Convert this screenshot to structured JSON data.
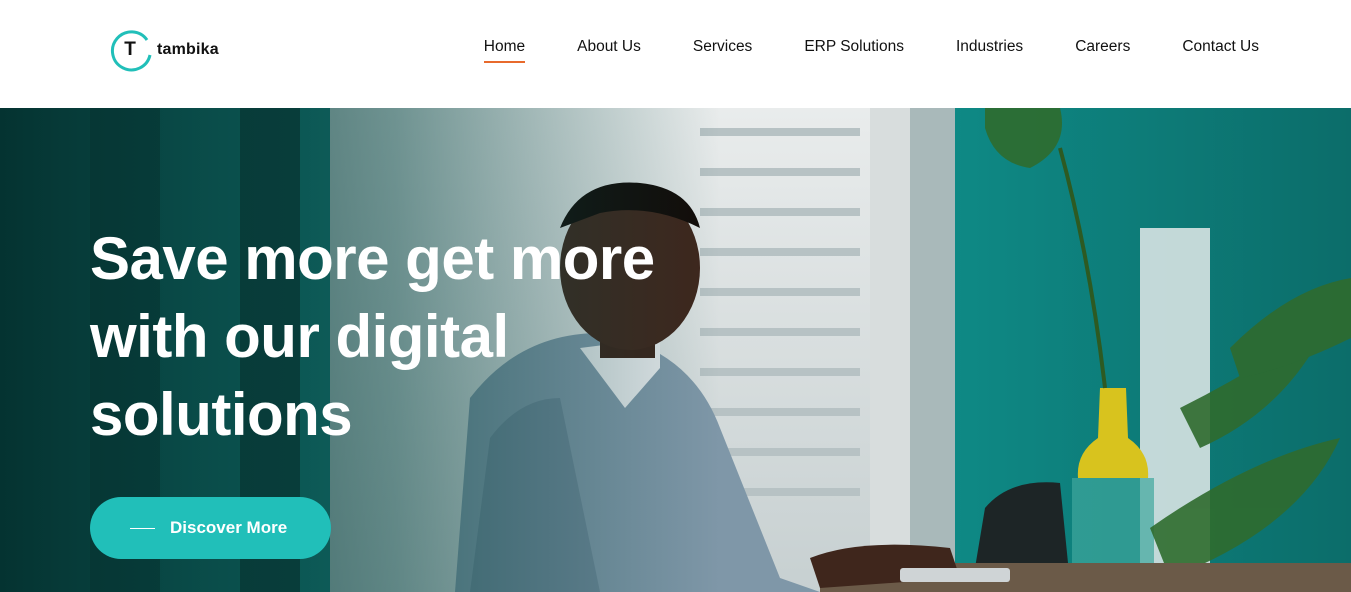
{
  "brand": {
    "logo_letter": "T",
    "name": "tambika",
    "accent_color": "#21bfb9"
  },
  "nav": {
    "items": [
      {
        "label": "Home",
        "active": true
      },
      {
        "label": "About Us"
      },
      {
        "label": "Services"
      },
      {
        "label": "ERP Solutions"
      },
      {
        "label": "Industries"
      },
      {
        "label": "Careers"
      },
      {
        "label": "Contact Us"
      }
    ],
    "active_underline_color": "#e86a2c"
  },
  "hero": {
    "title_lines": [
      "Save more get more",
      "with our digital",
      "solutions"
    ],
    "cta_label": "Discover More",
    "cta_color": "#21bfb9"
  }
}
